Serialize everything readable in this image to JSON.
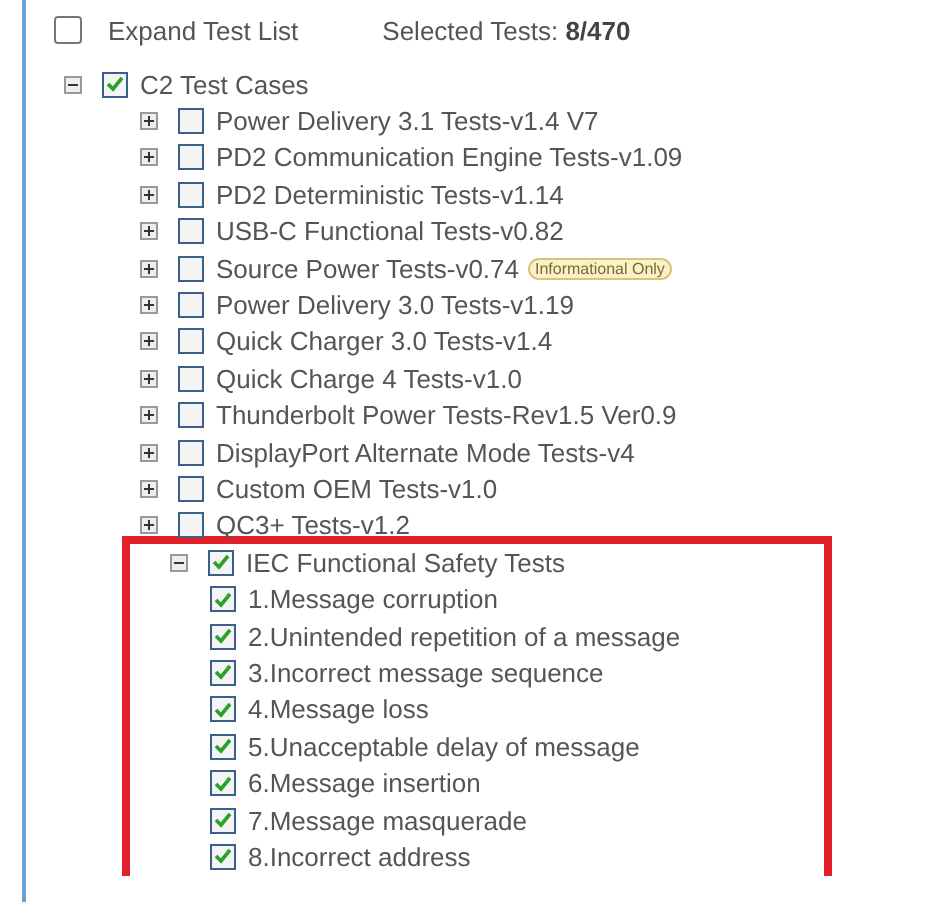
{
  "header": {
    "expand_label": "Expand Test List",
    "expand_checked": false,
    "selected_label": "Selected Tests:",
    "selected_count": "8/470"
  },
  "tree": [
    {
      "label": "C2 Test Cases",
      "checked": true,
      "expanded": true,
      "children": [
        {
          "label": "Power Delivery 3.1 Tests-v1.4 V7",
          "checked": false,
          "expanded": false
        },
        {
          "label": "PD2 Communication Engine Tests-v1.09",
          "checked": false,
          "expanded": false
        },
        {
          "label": "PD2 Deterministic Tests-v1.14",
          "checked": false,
          "expanded": false
        },
        {
          "label": "USB-C Functional Tests-v0.82",
          "checked": false,
          "expanded": false
        },
        {
          "label": "Source Power Tests-v0.74",
          "checked": false,
          "expanded": false,
          "badge": "Informational Only"
        },
        {
          "label": "Power Delivery 3.0 Tests-v1.19",
          "checked": false,
          "expanded": false
        },
        {
          "label": "Quick Charger 3.0 Tests-v1.4",
          "checked": false,
          "expanded": false
        },
        {
          "label": "Quick Charge 4 Tests-v1.0",
          "checked": false,
          "expanded": false
        },
        {
          "label": "Thunderbolt Power Tests-Rev1.5 Ver0.9",
          "checked": false,
          "expanded": false
        },
        {
          "label": "DisplayPort Alternate Mode Tests-v4",
          "checked": false,
          "expanded": false
        },
        {
          "label": "Custom OEM Tests-v1.0",
          "checked": false,
          "expanded": false
        },
        {
          "label": "QC3+ Tests-v1.2",
          "checked": false,
          "expanded": false
        },
        {
          "label": "IEC Functional Safety Tests",
          "checked": true,
          "expanded": true,
          "highlighted": true,
          "children": [
            {
              "label": "1.Message corruption",
              "checked": true
            },
            {
              "label": "2.Unintended repetition of a message",
              "checked": true
            },
            {
              "label": "3.Incorrect message sequence",
              "checked": true
            },
            {
              "label": "4.Message loss",
              "checked": true
            },
            {
              "label": "5.Unacceptable delay of message",
              "checked": true
            },
            {
              "label": "6.Message insertion",
              "checked": true
            },
            {
              "label": "7.Message masquerade",
              "checked": true
            },
            {
              "label": "8.Incorrect address",
              "checked": true
            }
          ]
        }
      ]
    }
  ]
}
